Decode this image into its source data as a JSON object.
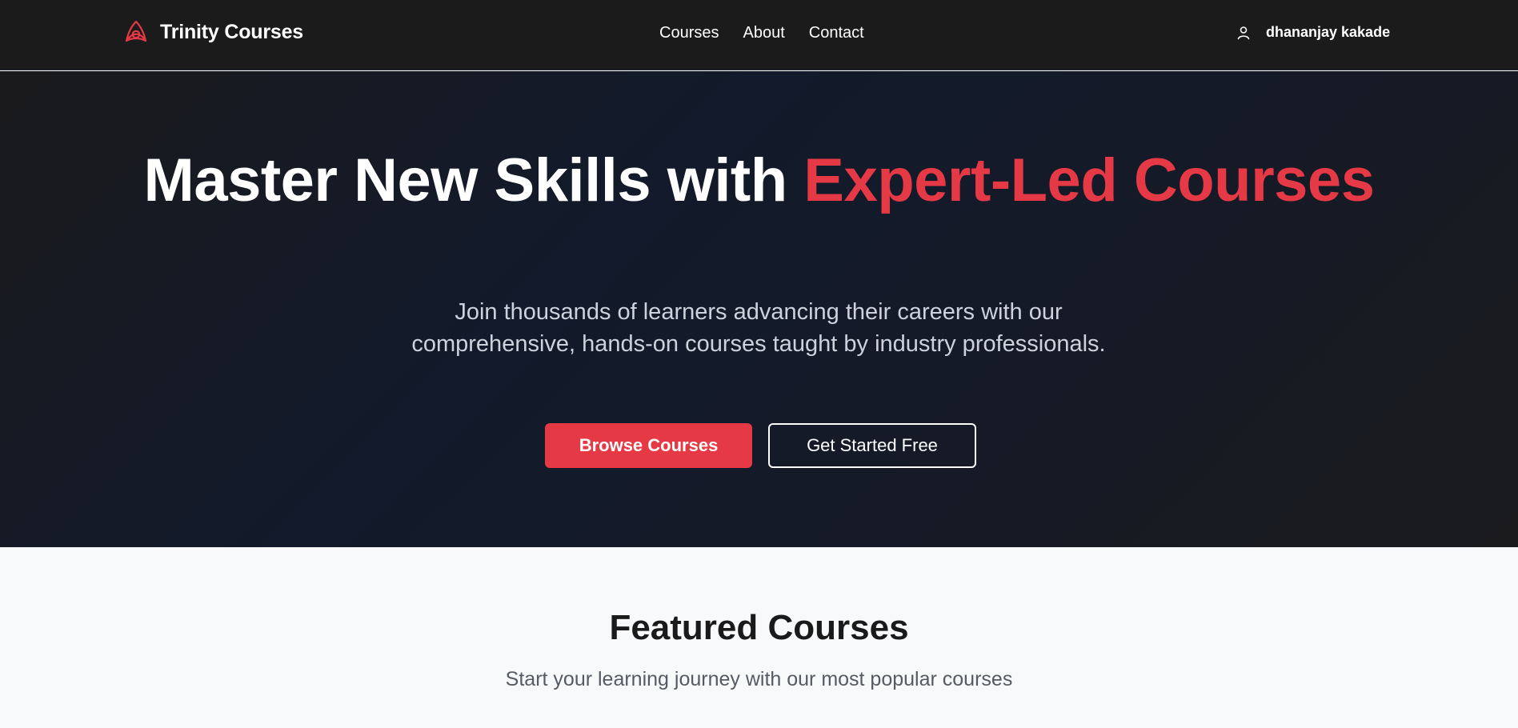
{
  "navbar": {
    "brand_name": "Trinity Courses",
    "brand_icon": "triquetra-logo-icon",
    "links": [
      {
        "label": "Courses"
      },
      {
        "label": "About"
      },
      {
        "label": "Contact"
      }
    ],
    "user": {
      "icon": "user-icon",
      "name": "dhananjay kakade"
    }
  },
  "hero": {
    "title_main": "Master New Skills with ",
    "title_accent": "Expert-Led Courses",
    "subtitle": "Join thousands of learners advancing their careers with our comprehensive, hands-on courses taught by industry professionals.",
    "primary_button": "Browse Courses",
    "secondary_button": "Get Started Free"
  },
  "featured": {
    "title": "Featured Courses",
    "subtitle": "Start your learning journey with our most popular courses"
  },
  "colors": {
    "accent": "#e63946",
    "nav_background": "#1b1b1b",
    "hero_background": "#121a2b",
    "section_background": "#f8f9fb"
  }
}
